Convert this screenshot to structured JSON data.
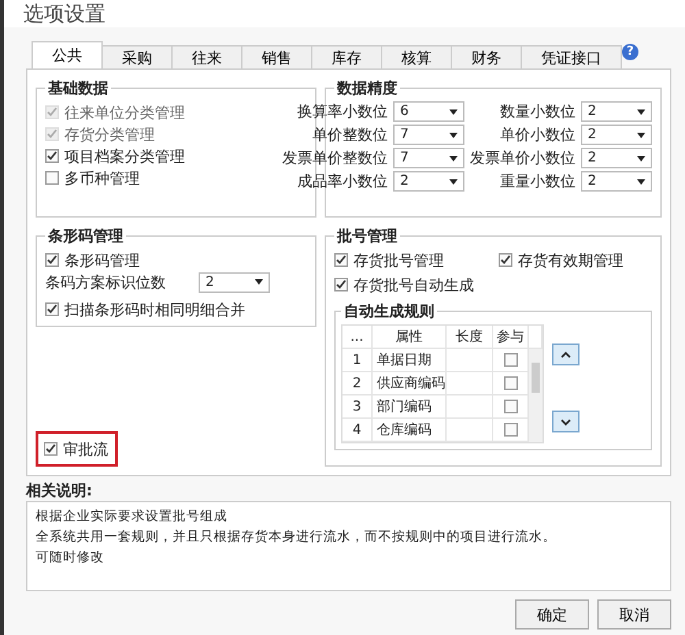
{
  "window": {
    "title": "选项设置"
  },
  "tabs": [
    {
      "label": "公共",
      "selected": true
    },
    {
      "label": "采购",
      "selected": false
    },
    {
      "label": "往来",
      "selected": false
    },
    {
      "label": "销售",
      "selected": false
    },
    {
      "label": "库存",
      "selected": false
    },
    {
      "label": "核算",
      "selected": false
    },
    {
      "label": "财务",
      "selected": false
    },
    {
      "label": "凭证接口",
      "selected": false
    }
  ],
  "help": {
    "icon": "?"
  },
  "basic_data": {
    "title": "基础数据",
    "items": [
      {
        "label": "往来单位分类管理",
        "checked": true,
        "disabled": true
      },
      {
        "label": "存货分类管理",
        "checked": true,
        "disabled": true
      },
      {
        "label": "项目档案分类管理",
        "checked": true,
        "disabled": false
      },
      {
        "label": "多币种管理",
        "checked": false,
        "disabled": false
      }
    ]
  },
  "precision": {
    "title": "数据精度",
    "rows": [
      [
        {
          "label": "换算率小数位",
          "value": "6"
        },
        {
          "label": "数量小数位",
          "value": "2"
        }
      ],
      [
        {
          "label": "单价整数位",
          "value": "7"
        },
        {
          "label": "单价小数位",
          "value": "2"
        }
      ],
      [
        {
          "label": "发票单价整数位",
          "value": "7"
        },
        {
          "label": "发票单价小数位",
          "value": "2"
        }
      ],
      [
        {
          "label": "成品率小数位",
          "value": "2"
        },
        {
          "label": "重量小数位",
          "value": "2"
        }
      ]
    ]
  },
  "barcode": {
    "title": "条形码管理",
    "manage": {
      "label": "条形码管理",
      "checked": true
    },
    "digits": {
      "label": "条码方案标识位数",
      "value": "2"
    },
    "merge": {
      "label": "扫描条形码时相同明细合并",
      "checked": true
    }
  },
  "batch": {
    "title": "批号管理",
    "checks": [
      {
        "label": "存货批号管理",
        "checked": true
      },
      {
        "label": "存货有效期管理",
        "checked": true
      },
      {
        "label": "存货批号自动生成",
        "checked": true
      }
    ],
    "rule": {
      "title": "自动生成规则",
      "columns": [
        "...",
        "属性",
        "长度",
        "参与"
      ],
      "rows": [
        {
          "index": "1",
          "attribute": "单据日期",
          "checked": false
        },
        {
          "index": "2",
          "attribute": "供应商编码",
          "checked": false
        },
        {
          "index": "3",
          "attribute": "部门编码",
          "checked": false
        },
        {
          "index": "4",
          "attribute": "仓库编码",
          "checked": false
        }
      ]
    }
  },
  "approval": {
    "label": "审批流",
    "checked": true,
    "highlighted": true
  },
  "notes": {
    "title": "相关说明:",
    "lines": [
      "根据企业实际要求设置批号组成",
      "全系统共用一套规则，并且只根据存货本身进行流水，而不按规则中的项目进行流水。",
      "可随时修改"
    ]
  },
  "buttons": [
    "确定",
    "取消"
  ]
}
